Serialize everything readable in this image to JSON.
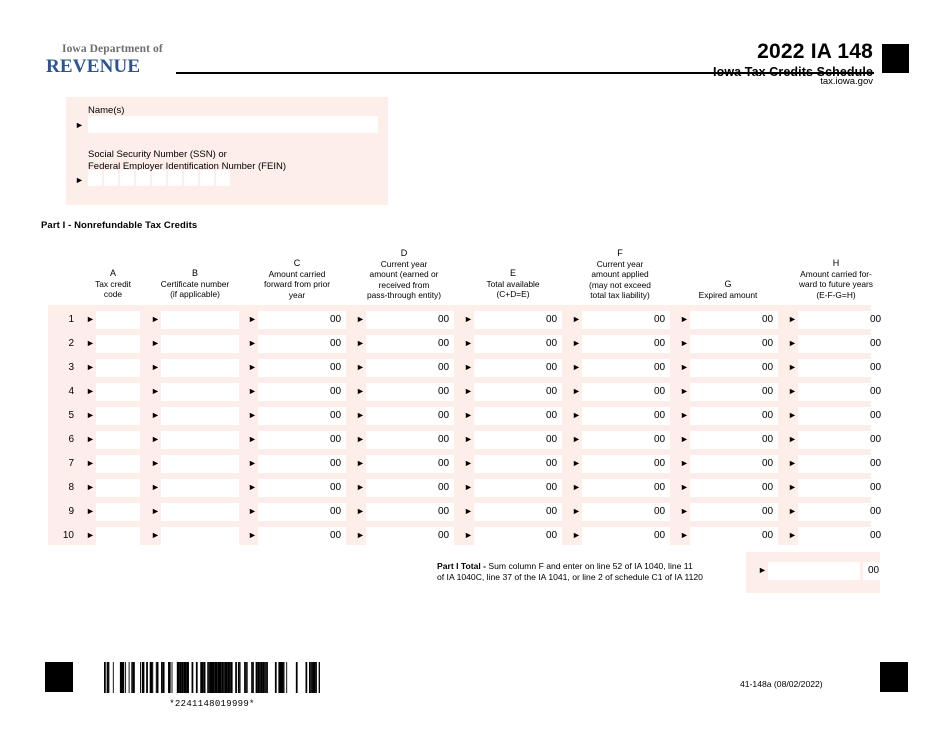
{
  "header": {
    "logo_top": "Iowa Department of",
    "logo_main": "REVENUE",
    "title": "2022 IA 148",
    "subtitle": "Iowa Tax Credits Schedule",
    "website": "tax.iowa.gov",
    "accent_color": "#2b5490"
  },
  "identification": {
    "name_label": "Name(s)",
    "name_value": "",
    "ssn_label_line1": "Social Security Number (SSN) or",
    "ssn_label_line2": "Federal Employer Identification Number (FEIN)",
    "ssn_digits": [
      "",
      "",
      "",
      "",
      "",
      "",
      "",
      "",
      ""
    ],
    "arrow_icon": "►",
    "panel_color": "#fdeeea"
  },
  "part1": {
    "heading": "Part I - Nonrefundable Tax Credits",
    "columns": [
      {
        "letter": "A",
        "desc_lines": [
          "Tax credit",
          "code"
        ]
      },
      {
        "letter": "B",
        "desc_lines": [
          "Certificate number",
          "(if applicable)"
        ]
      },
      {
        "letter": "C",
        "desc_lines": [
          "Amount carried",
          "forward from prior",
          "year"
        ]
      },
      {
        "letter": "D",
        "desc_lines": [
          "Current year",
          "amount (earned or",
          "received from",
          "pass-through entity)"
        ]
      },
      {
        "letter": "E",
        "desc_lines": [
          "Total available",
          "(C+D=E)"
        ]
      },
      {
        "letter": "F",
        "desc_lines": [
          "Current year",
          "amount applied",
          "(may not exceed",
          "total tax liability)"
        ]
      },
      {
        "letter": "G",
        "desc_lines": [
          "Expired amount"
        ]
      },
      {
        "letter": "H",
        "desc_lines": [
          "Amount carried for-",
          "ward to future years",
          "(E-F-G=H)"
        ]
      }
    ],
    "row_numbers": [
      "1",
      "2",
      "3",
      "4",
      "5",
      "6",
      "7",
      "8",
      "9",
      "10"
    ],
    "cents_suffix": "00",
    "row_values": [
      [
        "",
        "",
        "",
        "",
        "",
        "",
        "",
        ""
      ],
      [
        "",
        "",
        "",
        "",
        "",
        "",
        "",
        ""
      ],
      [
        "",
        "",
        "",
        "",
        "",
        "",
        "",
        ""
      ],
      [
        "",
        "",
        "",
        "",
        "",
        "",
        "",
        ""
      ],
      [
        "",
        "",
        "",
        "",
        "",
        "",
        "",
        ""
      ],
      [
        "",
        "",
        "",
        "",
        "",
        "",
        "",
        ""
      ],
      [
        "",
        "",
        "",
        "",
        "",
        "",
        "",
        ""
      ],
      [
        "",
        "",
        "",
        "",
        "",
        "",
        "",
        ""
      ],
      [
        "",
        "",
        "",
        "",
        "",
        "",
        "",
        ""
      ],
      [
        "",
        "",
        "",
        "",
        "",
        "",
        "",
        ""
      ]
    ],
    "total_label_bold": "Part I Total - ",
    "total_label_line1": "Sum column F and enter on line 52 of IA 1040, line 11",
    "total_label_line2": "of IA 1040C, line 37 of the IA 1041, or line 2 of schedule C1 of IA 1120",
    "total_value": "",
    "total_cents": "00"
  },
  "footer": {
    "barcode_text": "*2241148019999*",
    "form_number": "41-148a (08/02/2022)"
  }
}
